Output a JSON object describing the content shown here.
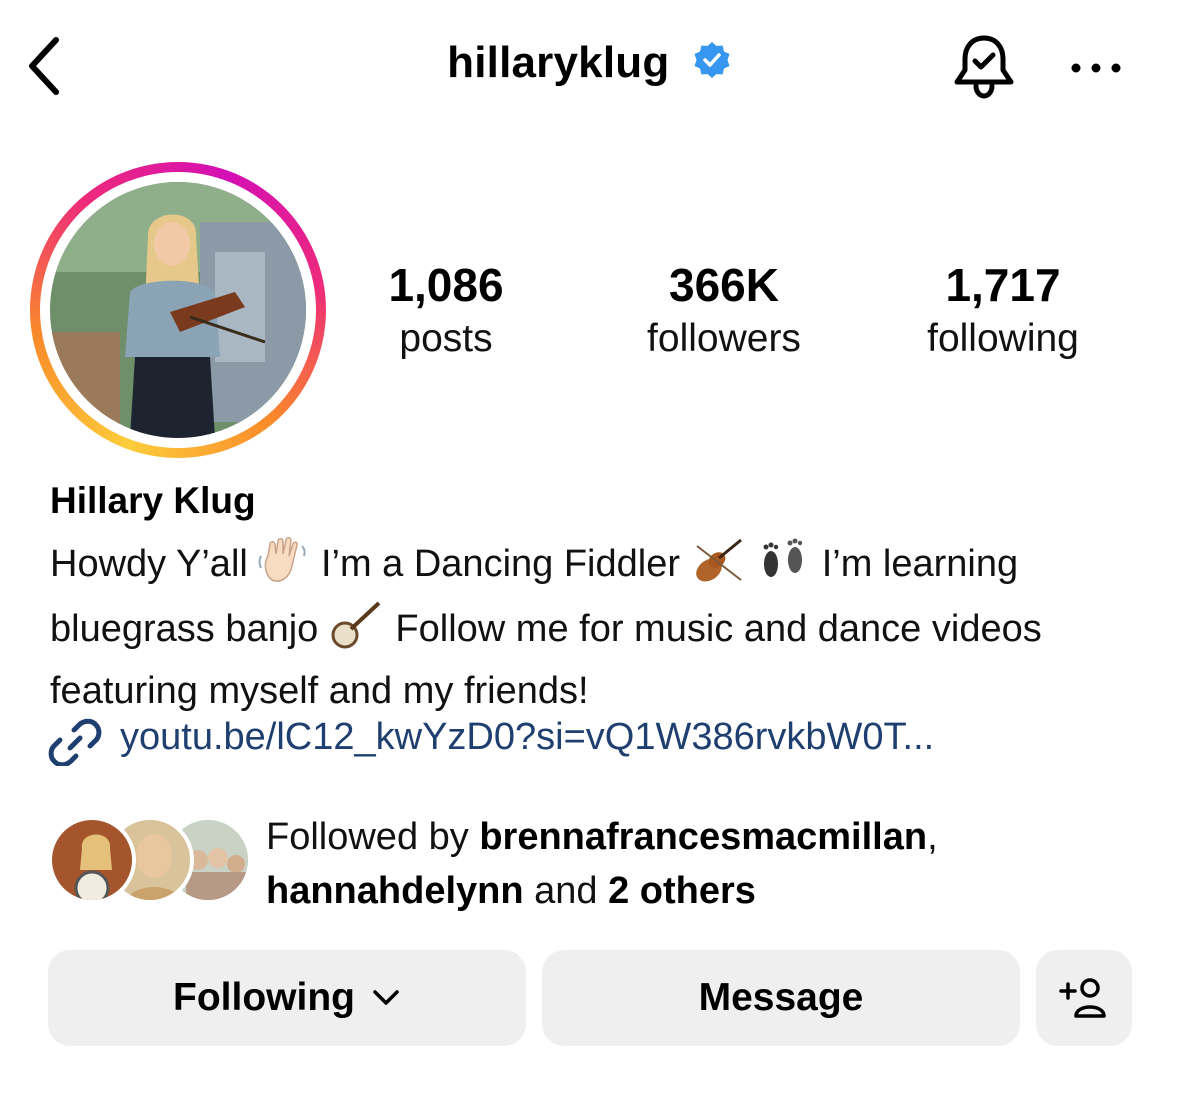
{
  "header": {
    "username": "hillaryklug",
    "verified": true,
    "icons": [
      "back-chevron-icon",
      "verified-badge-icon",
      "bell-check-icon",
      "more-dots-icon"
    ]
  },
  "stats": {
    "posts_count": "1,086",
    "posts_label": "posts",
    "followers_count": "366K",
    "followers_label": "followers",
    "following_count": "1,717",
    "following_label": "following"
  },
  "profile": {
    "display_name": "Hillary Klug",
    "bio_part1": "Howdy Y’all ",
    "bio_part2": " I’m a Dancing Fiddler",
    "bio_part3": " I’m learning bluegrass banjo ",
    "bio_part4": " Follow me for music and dance videos featuring myself and my friends!",
    "bio_emojis": [
      "waving-hand",
      "violin",
      "footprints",
      "banjo"
    ],
    "link_text": "youtu.be/lC12_kwYzD0?si=vQ1W386rvkbW0T..."
  },
  "followed_by": {
    "prefix": "Followed by ",
    "user1": "brennafrancesmacmillan",
    "separator": ",",
    "user2": "hannahdelynn",
    "conjunction": " and ",
    "others": "2 others"
  },
  "actions": {
    "following_label": "Following",
    "message_label": "Message",
    "add_user_icon": "add-person-icon"
  },
  "colors": {
    "link": "#1f3f70",
    "verified": "#3797f0",
    "button_bg": "#efefef",
    "ring_start": "#fccc3a",
    "ring_end": "#d40fb5"
  }
}
